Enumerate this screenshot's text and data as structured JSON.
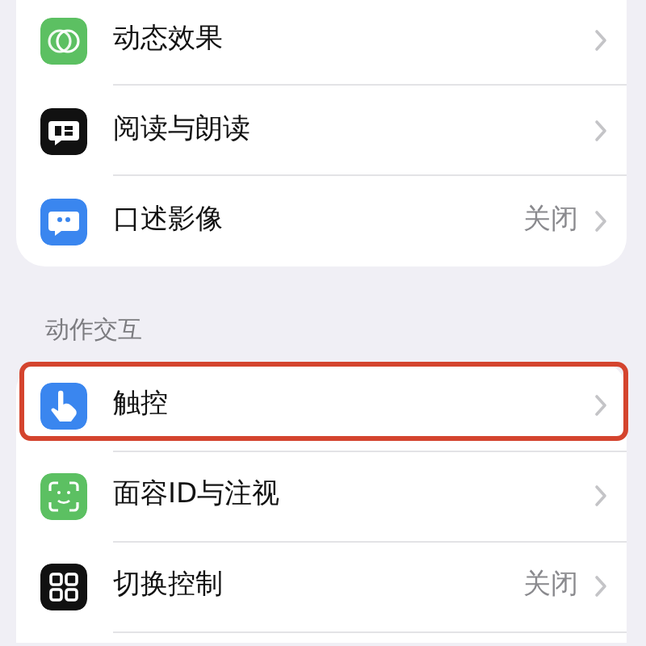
{
  "sections": [
    {
      "items": [
        {
          "kind": "motion",
          "label": "动态效果",
          "highlighted": false
        },
        {
          "kind": "speech",
          "label": "阅读与朗读",
          "highlighted": false
        },
        {
          "kind": "quote",
          "label": "口述影像",
          "value": "关闭",
          "highlighted": false
        }
      ]
    },
    {
      "header": "动作交互",
      "items": [
        {
          "kind": "touch",
          "label": "触控",
          "highlighted": true
        },
        {
          "kind": "faceid",
          "label": "面容ID与注视",
          "highlighted": false
        },
        {
          "kind": "switch",
          "label": "切换控制",
          "value": "关闭",
          "highlighted": false
        }
      ]
    }
  ]
}
